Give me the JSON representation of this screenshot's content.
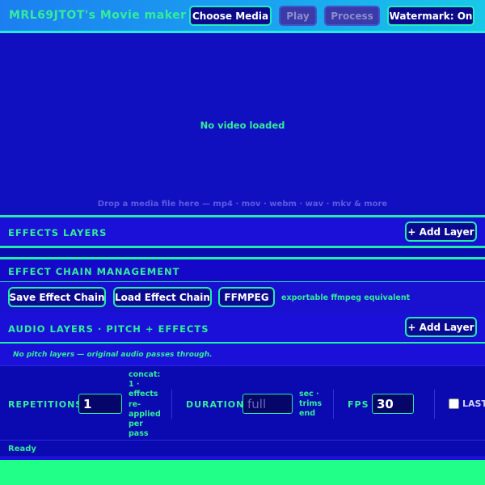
{
  "header": {
    "title": "MRL69JTOT's Movie maker",
    "choose_media": "Choose Media",
    "play": "Play",
    "process": "Process",
    "watermark": "Watermark: On"
  },
  "video": {
    "empty_text": "No video loaded",
    "drop_hint": "Drop a media file here — mp4 · mov · webm · wav · mkv & more"
  },
  "effects_layers": {
    "title": "EFFECTS LAYERS",
    "add_button": "+ Add Layer"
  },
  "effect_chain": {
    "title": "EFFECT CHAIN MANAGEMENT",
    "save_button": "Save Effect Chain",
    "load_button": "Load Effect Chain",
    "ffmpeg_button": "FFMPEG",
    "ffmpeg_note": "exportable ffmpeg equivalent"
  },
  "audio_layers": {
    "title": "AUDIO LAYERS · PITCH + EFFECTS",
    "add_button": "+ Add Layer",
    "empty_text": "No pitch layers — original audio passes through."
  },
  "params": {
    "repetitions_label": "REPETITIONS",
    "repetitions_value": "1",
    "repetitions_note": [
      "concat:",
      "1 ·",
      "effects",
      "re-",
      "applied",
      "per",
      "pass"
    ],
    "duration_label": "DURATION",
    "duration_placeholder": "full",
    "duration_note": [
      "sec ·",
      "trims",
      "end"
    ],
    "fps_label": "FPS",
    "fps_value": "30",
    "last_label": "LAST"
  },
  "status": {
    "text": "Ready"
  },
  "colors": {
    "background": "#0a0ab0",
    "accent": "#33ee99",
    "bottom_bar": "#22ff88"
  }
}
